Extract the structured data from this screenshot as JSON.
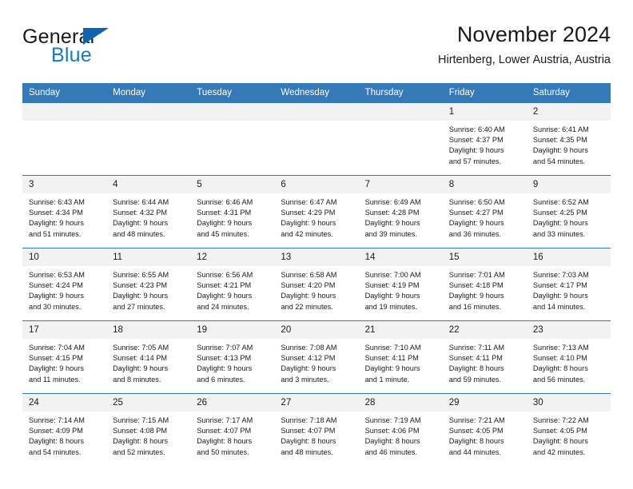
{
  "brand": {
    "name_part1": "General",
    "name_part2": "Blue",
    "triangle_color": "#1263ad",
    "blue_color": "#1779c4"
  },
  "header": {
    "title": "November 2024",
    "subtitle": "Hirtenberg, Lower Austria, Austria"
  },
  "calendar": {
    "header_bg": "#3579b8",
    "daynum_bg": "#f2f2f2",
    "weekday_headers": [
      "Sunday",
      "Monday",
      "Tuesday",
      "Wednesday",
      "Thursday",
      "Friday",
      "Saturday"
    ],
    "labels": {
      "sunrise": "Sunrise:",
      "sunset": "Sunset:",
      "daylight": "Daylight:"
    },
    "weeks": [
      [
        {
          "day": "",
          "empty": true
        },
        {
          "day": "",
          "empty": true
        },
        {
          "day": "",
          "empty": true
        },
        {
          "day": "",
          "empty": true
        },
        {
          "day": "",
          "empty": true
        },
        {
          "day": "1",
          "sunrise": "Sunrise: 6:40 AM",
          "sunset": "Sunset: 4:37 PM",
          "daylight_1": "Daylight: 9 hours",
          "daylight_2": "and 57 minutes."
        },
        {
          "day": "2",
          "sunrise": "Sunrise: 6:41 AM",
          "sunset": "Sunset: 4:35 PM",
          "daylight_1": "Daylight: 9 hours",
          "daylight_2": "and 54 minutes."
        }
      ],
      [
        {
          "day": "3",
          "sunrise": "Sunrise: 6:43 AM",
          "sunset": "Sunset: 4:34 PM",
          "daylight_1": "Daylight: 9 hours",
          "daylight_2": "and 51 minutes."
        },
        {
          "day": "4",
          "sunrise": "Sunrise: 6:44 AM",
          "sunset": "Sunset: 4:32 PM",
          "daylight_1": "Daylight: 9 hours",
          "daylight_2": "and 48 minutes."
        },
        {
          "day": "5",
          "sunrise": "Sunrise: 6:46 AM",
          "sunset": "Sunset: 4:31 PM",
          "daylight_1": "Daylight: 9 hours",
          "daylight_2": "and 45 minutes."
        },
        {
          "day": "6",
          "sunrise": "Sunrise: 6:47 AM",
          "sunset": "Sunset: 4:29 PM",
          "daylight_1": "Daylight: 9 hours",
          "daylight_2": "and 42 minutes."
        },
        {
          "day": "7",
          "sunrise": "Sunrise: 6:49 AM",
          "sunset": "Sunset: 4:28 PM",
          "daylight_1": "Daylight: 9 hours",
          "daylight_2": "and 39 minutes."
        },
        {
          "day": "8",
          "sunrise": "Sunrise: 6:50 AM",
          "sunset": "Sunset: 4:27 PM",
          "daylight_1": "Daylight: 9 hours",
          "daylight_2": "and 36 minutes."
        },
        {
          "day": "9",
          "sunrise": "Sunrise: 6:52 AM",
          "sunset": "Sunset: 4:25 PM",
          "daylight_1": "Daylight: 9 hours",
          "daylight_2": "and 33 minutes."
        }
      ],
      [
        {
          "day": "10",
          "sunrise": "Sunrise: 6:53 AM",
          "sunset": "Sunset: 4:24 PM",
          "daylight_1": "Daylight: 9 hours",
          "daylight_2": "and 30 minutes."
        },
        {
          "day": "11",
          "sunrise": "Sunrise: 6:55 AM",
          "sunset": "Sunset: 4:23 PM",
          "daylight_1": "Daylight: 9 hours",
          "daylight_2": "and 27 minutes."
        },
        {
          "day": "12",
          "sunrise": "Sunrise: 6:56 AM",
          "sunset": "Sunset: 4:21 PM",
          "daylight_1": "Daylight: 9 hours",
          "daylight_2": "and 24 minutes."
        },
        {
          "day": "13",
          "sunrise": "Sunrise: 6:58 AM",
          "sunset": "Sunset: 4:20 PM",
          "daylight_1": "Daylight: 9 hours",
          "daylight_2": "and 22 minutes."
        },
        {
          "day": "14",
          "sunrise": "Sunrise: 7:00 AM",
          "sunset": "Sunset: 4:19 PM",
          "daylight_1": "Daylight: 9 hours",
          "daylight_2": "and 19 minutes."
        },
        {
          "day": "15",
          "sunrise": "Sunrise: 7:01 AM",
          "sunset": "Sunset: 4:18 PM",
          "daylight_1": "Daylight: 9 hours",
          "daylight_2": "and 16 minutes."
        },
        {
          "day": "16",
          "sunrise": "Sunrise: 7:03 AM",
          "sunset": "Sunset: 4:17 PM",
          "daylight_1": "Daylight: 9 hours",
          "daylight_2": "and 14 minutes."
        }
      ],
      [
        {
          "day": "17",
          "sunrise": "Sunrise: 7:04 AM",
          "sunset": "Sunset: 4:15 PM",
          "daylight_1": "Daylight: 9 hours",
          "daylight_2": "and 11 minutes."
        },
        {
          "day": "18",
          "sunrise": "Sunrise: 7:05 AM",
          "sunset": "Sunset: 4:14 PM",
          "daylight_1": "Daylight: 9 hours",
          "daylight_2": "and 8 minutes."
        },
        {
          "day": "19",
          "sunrise": "Sunrise: 7:07 AM",
          "sunset": "Sunset: 4:13 PM",
          "daylight_1": "Daylight: 9 hours",
          "daylight_2": "and 6 minutes."
        },
        {
          "day": "20",
          "sunrise": "Sunrise: 7:08 AM",
          "sunset": "Sunset: 4:12 PM",
          "daylight_1": "Daylight: 9 hours",
          "daylight_2": "and 3 minutes."
        },
        {
          "day": "21",
          "sunrise": "Sunrise: 7:10 AM",
          "sunset": "Sunset: 4:11 PM",
          "daylight_1": "Daylight: 9 hours",
          "daylight_2": "and 1 minute."
        },
        {
          "day": "22",
          "sunrise": "Sunrise: 7:11 AM",
          "sunset": "Sunset: 4:11 PM",
          "daylight_1": "Daylight: 8 hours",
          "daylight_2": "and 59 minutes."
        },
        {
          "day": "23",
          "sunrise": "Sunrise: 7:13 AM",
          "sunset": "Sunset: 4:10 PM",
          "daylight_1": "Daylight: 8 hours",
          "daylight_2": "and 56 minutes."
        }
      ],
      [
        {
          "day": "24",
          "sunrise": "Sunrise: 7:14 AM",
          "sunset": "Sunset: 4:09 PM",
          "daylight_1": "Daylight: 8 hours",
          "daylight_2": "and 54 minutes."
        },
        {
          "day": "25",
          "sunrise": "Sunrise: 7:15 AM",
          "sunset": "Sunset: 4:08 PM",
          "daylight_1": "Daylight: 8 hours",
          "daylight_2": "and 52 minutes."
        },
        {
          "day": "26",
          "sunrise": "Sunrise: 7:17 AM",
          "sunset": "Sunset: 4:07 PM",
          "daylight_1": "Daylight: 8 hours",
          "daylight_2": "and 50 minutes."
        },
        {
          "day": "27",
          "sunrise": "Sunrise: 7:18 AM",
          "sunset": "Sunset: 4:07 PM",
          "daylight_1": "Daylight: 8 hours",
          "daylight_2": "and 48 minutes."
        },
        {
          "day": "28",
          "sunrise": "Sunrise: 7:19 AM",
          "sunset": "Sunset: 4:06 PM",
          "daylight_1": "Daylight: 8 hours",
          "daylight_2": "and 46 minutes."
        },
        {
          "day": "29",
          "sunrise": "Sunrise: 7:21 AM",
          "sunset": "Sunset: 4:05 PM",
          "daylight_1": "Daylight: 8 hours",
          "daylight_2": "and 44 minutes."
        },
        {
          "day": "30",
          "sunrise": "Sunrise: 7:22 AM",
          "sunset": "Sunset: 4:05 PM",
          "daylight_1": "Daylight: 8 hours",
          "daylight_2": "and 42 minutes."
        }
      ]
    ]
  }
}
